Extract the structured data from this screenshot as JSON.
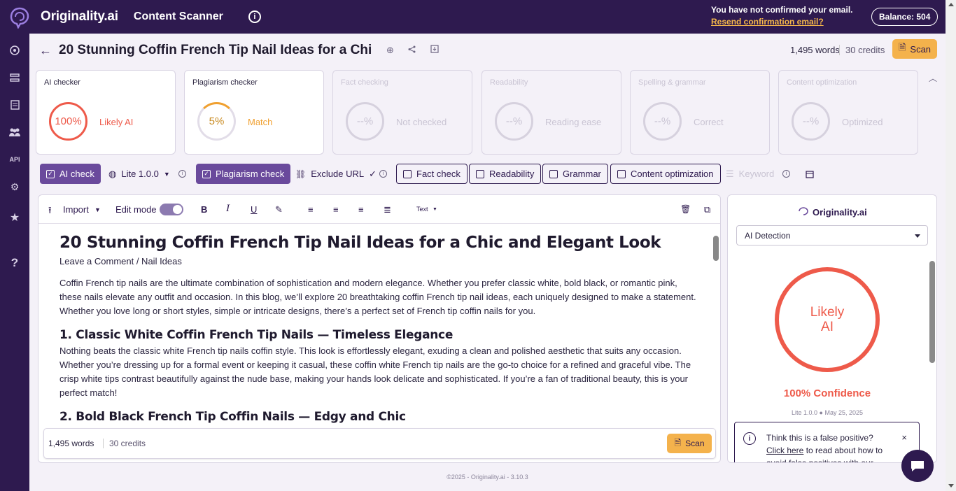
{
  "topbar": {
    "brand": "Originality.ai",
    "product": "Content Scanner",
    "email_notice": "You have not confirmed your email.",
    "resend_link": "Resend confirmation email?",
    "balance": "Balance: 504"
  },
  "doc": {
    "title": "20 Stunning Coffin French Tip Nail Ideas for a Chi",
    "words": "1,495 words",
    "credits": "30 credits",
    "scan_label": "Scan"
  },
  "cards": [
    {
      "title": "AI checker",
      "value": "100%",
      "status": "Likely AI"
    },
    {
      "title": "Plagiarism checker",
      "value": "5%",
      "status": "Match"
    },
    {
      "title": "Fact checking",
      "value": "--%",
      "status": "Not checked"
    },
    {
      "title": "Readability",
      "value": "--%",
      "status": "Reading ease"
    },
    {
      "title": "Spelling & grammar",
      "value": "--%",
      "status": "Correct"
    },
    {
      "title": "Content optimization",
      "value": "--%",
      "status": "Optimized"
    }
  ],
  "tools": {
    "ai_check": "AI check",
    "model": "Lite 1.0.0",
    "plagiarism_check": "Plagiarism check",
    "exclude_url": "Exclude URL",
    "fact_check": "Fact check",
    "readability": "Readability",
    "grammar": "Grammar",
    "content_optimization": "Content optimization",
    "keyword": "Keyword"
  },
  "editor": {
    "import": "Import",
    "edit_mode": "Edit mode",
    "text_style": "Text",
    "heading": "20 Stunning Coffin French Tip Nail Ideas for a Chic and Elegant Look",
    "meta": "Leave a Comment / Nail Ideas",
    "intro": "Coffin French tip nails are the ultimate combination of sophistication and modern elegance. Whether you prefer classic white, bold black, or romantic pink, these nails elevate any outfit and occasion. In this blog, we’ll explore 20 breathtaking coffin French tip nail ideas, each uniquely designed to make a statement. Whether you love long or short styles, simple or intricate designs, there’s a perfect set of French tip coffin nails for you.",
    "h2_1": "1. Classic White Coffin French Tip Nails — Timeless Elegance",
    "p1": "Nothing beats the classic white French tip nails coffin style. This look is effortlessly elegant, exuding a clean and polished aesthetic that suits any occasion. Whether you’re dressing up for a formal event or keeping it casual, these coffin white French tip nails are the go-to choice for a refined and graceful vibe. The crisp white tips contrast beautifully against the nude base, making your hands look delicate and sophisticated. If you’re a fan of traditional beauty, this is your perfect match!",
    "h2_2": "2. Bold Black French Tip Coffin Nails — Edgy and Chic",
    "footer_words": "1,495 words",
    "footer_credits": "30 credits",
    "footer_scan": "Scan"
  },
  "panel": {
    "brand": "Originality.ai",
    "select": "AI Detection",
    "ring_line1": "Likely",
    "ring_line2": "AI",
    "confidence": "100% Confidence",
    "version": "Lite 1.0.0 ● May 25, 2025",
    "fp_question": "Think this is a false positive?",
    "fp_link": "Click here",
    "fp_rest": " to read about how to avoid false positives with our"
  },
  "footer": "©2025 - Originality.ai - 3.10.3",
  "colors": {
    "brand": "#2e1a4f",
    "accent": "#f4b24c",
    "ai_red": "#ee5a4a",
    "match_orange": "#f0a030",
    "tool_on": "#6a4a9c"
  }
}
